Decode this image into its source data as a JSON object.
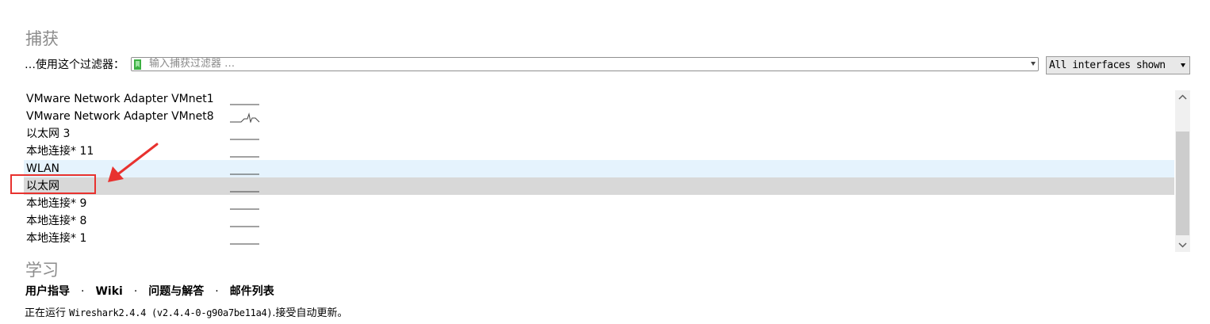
{
  "capture": {
    "title": "捕获",
    "filter_label": "…使用这个过滤器：",
    "filter_placeholder": "输入捕获过滤器 …",
    "interfaces_select": "All interfaces shown"
  },
  "interfaces": [
    {
      "name": "VMware Network Adapter VMnet1",
      "activity": "flat"
    },
    {
      "name": "VMware Network Adapter VMnet8",
      "activity": "spike"
    },
    {
      "name": "以太网 3",
      "activity": "flat"
    },
    {
      "name": "本地连接* 11",
      "activity": "flat"
    },
    {
      "name": "WLAN",
      "activity": "flat",
      "state": "hover"
    },
    {
      "name": "以太网",
      "activity": "flat",
      "state": "selected"
    },
    {
      "name": "本地连接* 9",
      "activity": "flat"
    },
    {
      "name": "本地连接* 8",
      "activity": "flat"
    },
    {
      "name": "本地连接* 1",
      "activity": "flat"
    }
  ],
  "learn": {
    "title": "学习",
    "links": [
      "用户指导",
      "Wiki",
      "问题与解答",
      "邮件列表"
    ],
    "separator": "·"
  },
  "status": {
    "prefix": "正在运行 ",
    "version": "Wireshark2.4.4 (v2.4.4-0-g90a7be11a4)",
    "suffix": ".接受自动更新。"
  },
  "colors": {
    "accent_annotation": "#e8322f",
    "bookmark": "#3cb043",
    "hover_row": "#e5f3fd",
    "selected_row": "#d8d8d8"
  },
  "icons": {
    "filter_bookmark": "bookmark-icon",
    "scroll_up": "chevron-up-icon",
    "scroll_down": "chevron-down-icon"
  }
}
